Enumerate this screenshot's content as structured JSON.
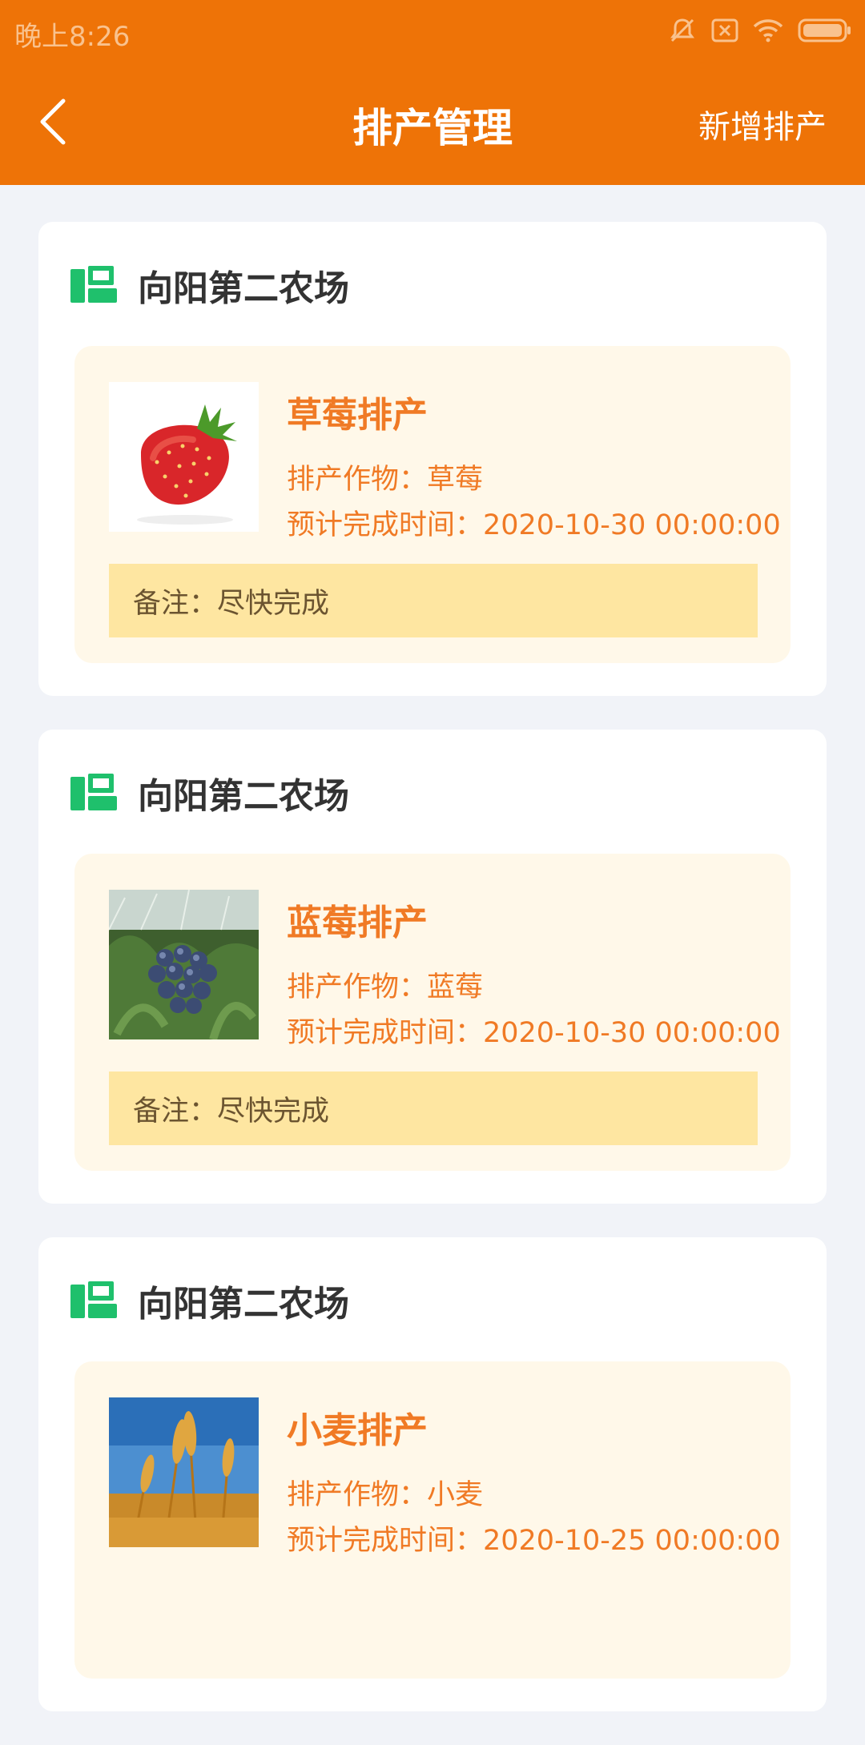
{
  "status_bar": {
    "time": "晚上8:26"
  },
  "nav": {
    "title": "排产管理",
    "action_label": "新增排产"
  },
  "colors": {
    "header": "#ee7307",
    "accent_text": "#f07a25",
    "farm_icon": "#1fc06c",
    "note_bg": "#fee6a1"
  },
  "cards": [
    {
      "farm_name": "向阳第二农场",
      "title": "草莓排产",
      "crop_label": "排产作物：草莓",
      "time_label": "预计完成时间：2020-10-30 00:00:00",
      "note_label": "备注：尽快完成",
      "image": "strawberry"
    },
    {
      "farm_name": "向阳第二农场",
      "title": "蓝莓排产",
      "crop_label": "排产作物：蓝莓",
      "time_label": "预计完成时间：2020-10-30 00:00:00",
      "note_label": "备注：尽快完成",
      "image": "blueberry"
    },
    {
      "farm_name": "向阳第二农场",
      "title": "小麦排产",
      "crop_label": "排产作物：小麦",
      "time_label": "预计完成时间：2020-10-25 00:00:00",
      "image": "wheat"
    }
  ]
}
